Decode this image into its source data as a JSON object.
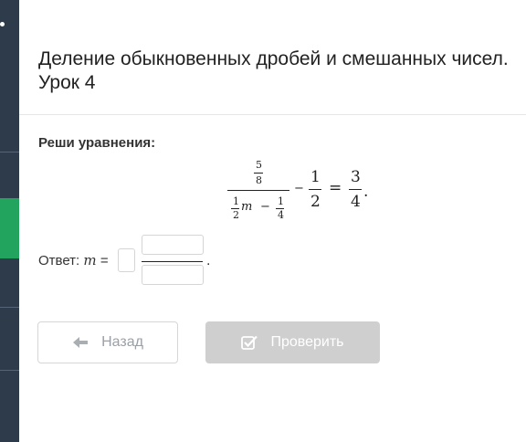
{
  "lesson": {
    "title": "Деление обыкновенных дробей и смешанных чисел. Урок 4"
  },
  "task": {
    "prompt": "Реши уравнения:",
    "equation": {
      "top_num": "5",
      "top_den": "8",
      "bottom": {
        "h_num": "1",
        "h_den": "2",
        "var": "m",
        "minus": "−",
        "q_num": "1",
        "q_den": "4"
      },
      "minus": "−",
      "half_num": "1",
      "half_den": "2",
      "equals": "=",
      "rhs_num": "3",
      "rhs_den": "4",
      "period": "."
    }
  },
  "answer": {
    "label": "Ответ:",
    "var": "m",
    "equals": "=",
    "whole_value": "",
    "numerator_value": "",
    "denominator_value": "",
    "period": "."
  },
  "buttons": {
    "back": "Назад",
    "check": "Проверить"
  },
  "icons": {
    "back": "arrow-left-icon",
    "check": "checkbox-check-icon"
  },
  "colors": {
    "sidebar": "#2d3b4b",
    "sidebar_active": "#22a45e",
    "check_button_disabled": "#cfcfcf"
  }
}
